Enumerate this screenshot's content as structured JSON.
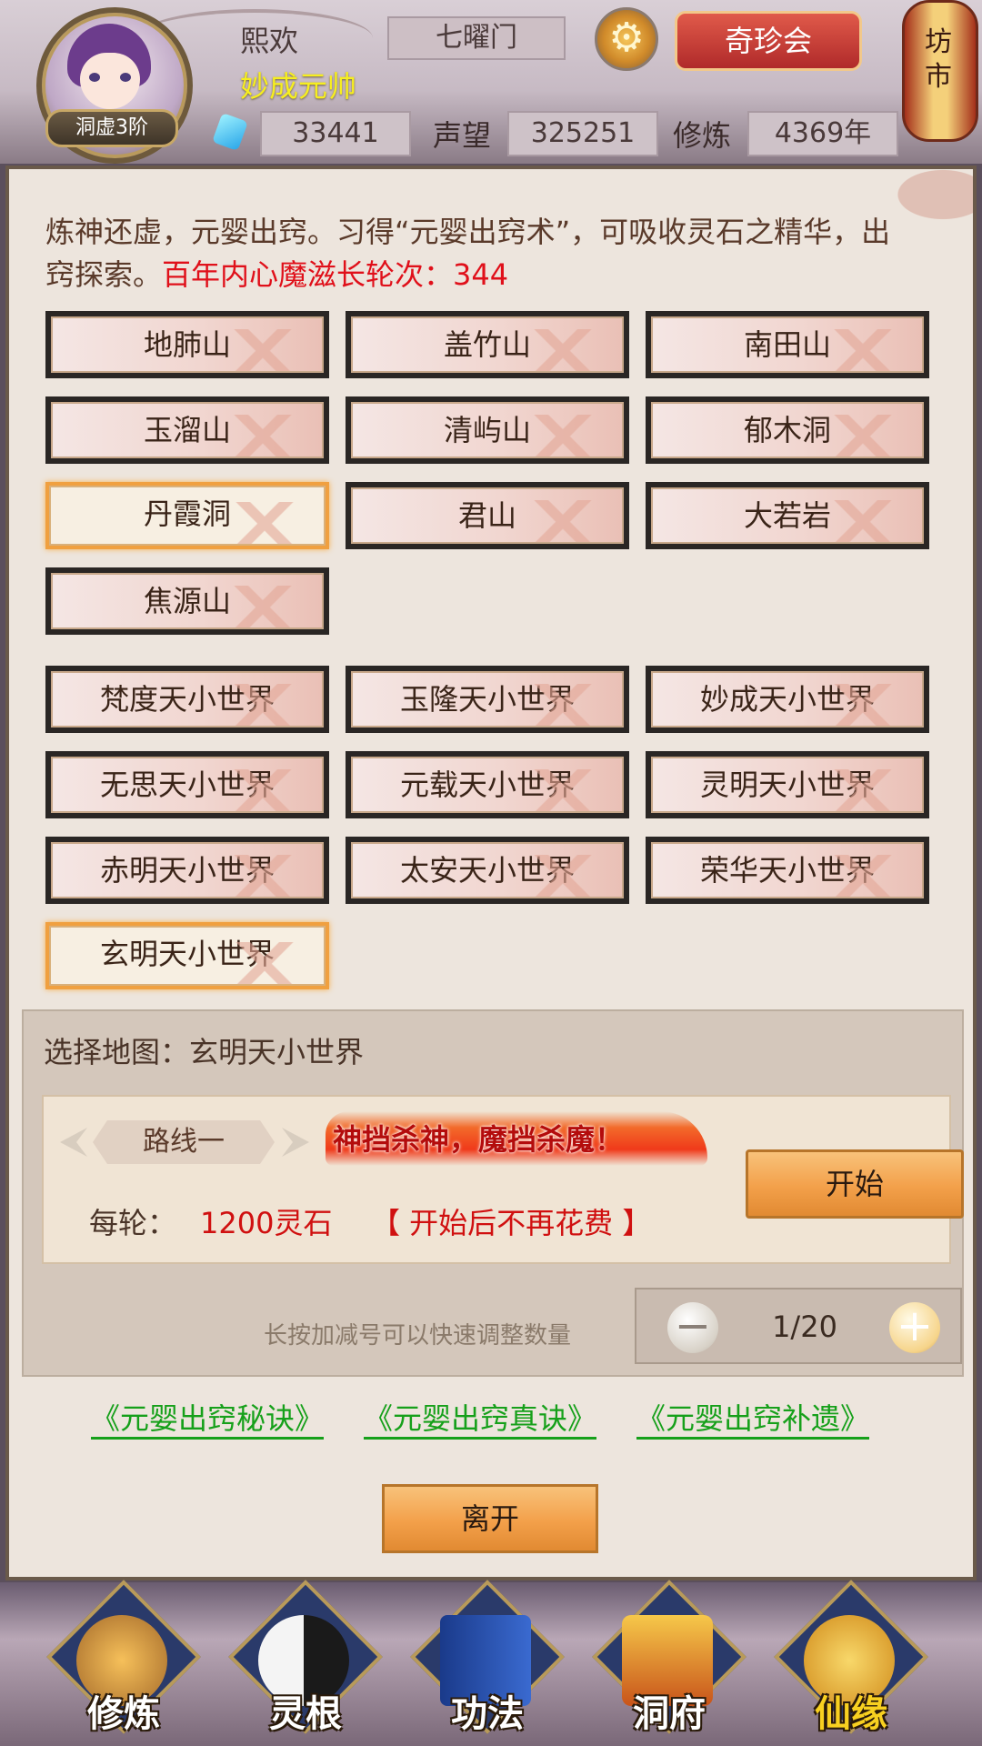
{
  "header": {
    "player_name": "熙欢",
    "player_title": "妙成元帅",
    "rank_badge": "洞虚3阶",
    "sect": "七曜门",
    "treasure_button": "奇珍会",
    "market_label": "坊市",
    "stats": {
      "spirit_stones": "33441",
      "reputation_label": "声望",
      "reputation_value": "325251",
      "cultivation_label": "修炼",
      "cultivation_value": "4369年"
    }
  },
  "intro": {
    "text": "炼神还虚，元婴出窍。习得“元婴出窍术”，可吸收灵石之精华，出窍探索。",
    "highlight": "百年内心魔滋长轮次：344"
  },
  "locations": {
    "mountains": [
      "地肺山",
      "盖竹山",
      "南田山",
      "玉溜山",
      "清屿山",
      "郁木洞",
      "丹霞洞",
      "君山",
      "大若岩",
      "焦源山"
    ],
    "worlds": [
      "梵度天小世界",
      "玉隆天小世界",
      "妙成天小世界",
      "无思天小世界",
      "元载天小世界",
      "灵明天小世界",
      "赤明天小世界",
      "太安天小世界",
      "荣华天小世界",
      "玄明天小世界"
    ],
    "selected_mountain": "丹霞洞",
    "selected_world": "玄明天小世界"
  },
  "selection": {
    "label": "选择地图：玄明天小世界",
    "route_tab": "路线一",
    "slogan": "神挡杀神，魔挡杀魔！",
    "start_button": "开始",
    "cost_label": "每轮：",
    "cost_value": "1200灵石",
    "cost_note": "【 开始后不再花费 】",
    "hint": "长按加减号可以快速调整数量",
    "stepper_value": "1/20",
    "minus_symbol": "−",
    "plus_symbol": "+"
  },
  "links": [
    "《元婴出窍秘诀》",
    "《元婴出窍真诀》",
    "《元婴出窍补遗》"
  ],
  "leave_button": "离开",
  "bottom_nav": [
    {
      "label": "修炼",
      "icon": "monk-icon"
    },
    {
      "label": "灵根",
      "icon": "yin-yang-sword-icon"
    },
    {
      "label": "功法",
      "icon": "scroll-book-icon"
    },
    {
      "label": "洞府",
      "icon": "pagoda-icon"
    },
    {
      "label": "仙缘",
      "icon": "gourd-icon"
    }
  ],
  "colors": {
    "accent_red": "#e0101a",
    "link_green": "#16a01a",
    "title_yellow": "#f6ee20",
    "button_orange": "#f3a04a"
  }
}
